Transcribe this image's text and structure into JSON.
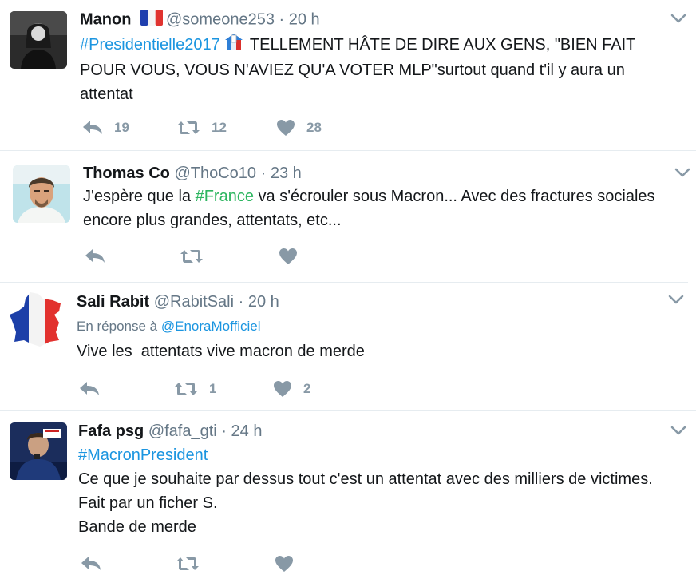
{
  "tweets": [
    {
      "name": "Manon",
      "handle": "@someone253",
      "separator": "·",
      "time": "20 h",
      "reply_label": "",
      "reply_mention": "",
      "hashtag": "#Presidentielle2017",
      "lines": [
        "TELLEMENT HÂTE DE DIRE AUX GENS, \"BIEN FAIT",
        "POUR VOUS, VOUS N'AVIEZ QU'A VOTER MLP\"surtout quand t'il y aura un",
        "attentat"
      ],
      "replies": "19",
      "retweets": "12",
      "likes": "28"
    },
    {
      "name": "Thomas Co",
      "handle": "@ThoCo10",
      "separator": "·",
      "time": "23 h",
      "body_prefix": "J'espère que la ",
      "hashtag": "#France",
      "body_suffix": " va s'écrouler sous Macron... Avec des fractures sociales",
      "line2": "encore plus grandes, attentats, etc...",
      "replies": "",
      "retweets": "",
      "likes": ""
    },
    {
      "name": "Sali Rabit",
      "handle": "@RabitSali",
      "separator": "·",
      "time": "20 h",
      "reply_label": "En réponse à",
      "reply_mention": "@EnoraMofficiel",
      "line1": "Vive les  attentats vive macron de merde",
      "replies": "",
      "retweets": "1",
      "likes": "2"
    },
    {
      "name": "Fafa psg",
      "handle": "@fafa_gti",
      "separator": "·",
      "time": "24 h",
      "hashtag": "#MacronPresident",
      "lines": [
        "Ce que je souhaite par dessus tout c'est un attentat avec des milliers de victimes.",
        "Fait par un ficher S.",
        "Bande de merde"
      ],
      "replies": "",
      "retweets": "",
      "likes": ""
    }
  ],
  "icons": {
    "reply": "reply-icon",
    "retweet": "retweet-icon",
    "like": "heart-icon",
    "more": "chevron-down-icon",
    "flag": "france-flag-icon",
    "ballot": "ballot-box-icon"
  },
  "colors": {
    "link": "#1b95e0",
    "hashtag_green": "#2cb55f",
    "secondary": "#657786",
    "action_gray": "#8899a6"
  }
}
